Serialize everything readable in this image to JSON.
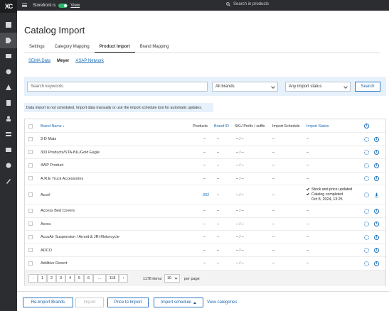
{
  "topbar": {
    "storefront_label": "Storefront is",
    "view_label": "View",
    "search_placeholder": "Search in products"
  },
  "page_title": "Catalog Import",
  "tabs": [
    {
      "label": "Settings"
    },
    {
      "label": "Category Mapping"
    },
    {
      "label": "Product Import"
    },
    {
      "label": "Brand Mapping"
    }
  ],
  "subtabs": [
    {
      "label": "SEMA Data"
    },
    {
      "label": "Meyer"
    },
    {
      "label": "ASAP Network"
    }
  ],
  "filters": {
    "keyword_placeholder": "Search keywords",
    "brand_value": "All brands",
    "status_value": "Any import status",
    "search_button": "Search"
  },
  "notice": "Data import is not scheduled. Import data manually or use the import schedule tool for automatic updates.",
  "table": {
    "headers": {
      "brand": "Brand Name ↓",
      "products": "Products",
      "brand_id": "Brand ID",
      "sku": "SKU Prefix / suffix",
      "schedule": "Import Schedule",
      "status": "Import Status"
    },
    "rows": [
      {
        "brand": "3-D Mats",
        "products": "–",
        "brand_id": "–",
        "sku": "– / –",
        "schedule": "–",
        "status": "–"
      },
      {
        "brand": "303 Products/STA-BIL/Gold Eagle",
        "products": "–",
        "brand_id": "–",
        "sku": "– / –",
        "schedule": "–",
        "status": "–"
      },
      {
        "brand": "4WP Product",
        "products": "–",
        "brand_id": "–",
        "sku": "– / –",
        "schedule": "–",
        "status": "–"
      },
      {
        "brand": "A.R.E Truck Accessories",
        "products": "–",
        "brand_id": "–",
        "sku": "– / –",
        "schedule": "–",
        "status": "–"
      },
      {
        "brand": "Accel",
        "products": "302",
        "brand_id": "–",
        "sku": "– / –",
        "schedule": "–",
        "status_lines": [
          "Stock and price updated",
          "Catalog completed",
          "Oct 8, 2024, 13:25"
        ]
      },
      {
        "brand": "Access Bed Covers",
        "products": "–",
        "brand_id": "–",
        "sku": "– / –",
        "schedule": "–",
        "status": "–"
      },
      {
        "brand": "Accra",
        "products": "–",
        "brand_id": "–",
        "sku": "– / –",
        "schedule": "–",
        "status": "–"
      },
      {
        "brand": "AccuAir Suspension / Arnott & JRi Motorcycle",
        "products": "–",
        "brand_id": "–",
        "sku": "– / –",
        "schedule": "–",
        "status": "–"
      },
      {
        "brand": "ADCO",
        "products": "–",
        "brand_id": "–",
        "sku": "– / –",
        "schedule": "–",
        "status": "–"
      },
      {
        "brand": "Additive Desert",
        "products": "–",
        "brand_id": "–",
        "sku": "– / –",
        "schedule": "–",
        "status": "–"
      }
    ]
  },
  "pagination": {
    "pages": [
      "1",
      "2",
      "3",
      "4",
      "5",
      "6",
      "...",
      "118"
    ],
    "prev": "‹",
    "next": "›",
    "total_items": "1178 items",
    "per_page_value": "10",
    "per_page_label": "per page"
  },
  "footer": {
    "reimport": "Re-Import Brands",
    "import": "Import",
    "price_to_import": "Price to Import",
    "import_schedule": "Import schedule",
    "view_categories": "View categories"
  },
  "colors": {
    "accent": "#1e6fb8",
    "rail": "#2b2d30",
    "toggle_on": "#2eb66e",
    "filter_bg": "#e6f1fb"
  },
  "icons": [
    "logo",
    "dashboard-icon",
    "tag-icon",
    "orders-icon",
    "truck-icon",
    "network-icon",
    "pages-icon",
    "user-icon",
    "layers-icon",
    "image-icon",
    "gear-icon",
    "wrench-icon"
  ]
}
